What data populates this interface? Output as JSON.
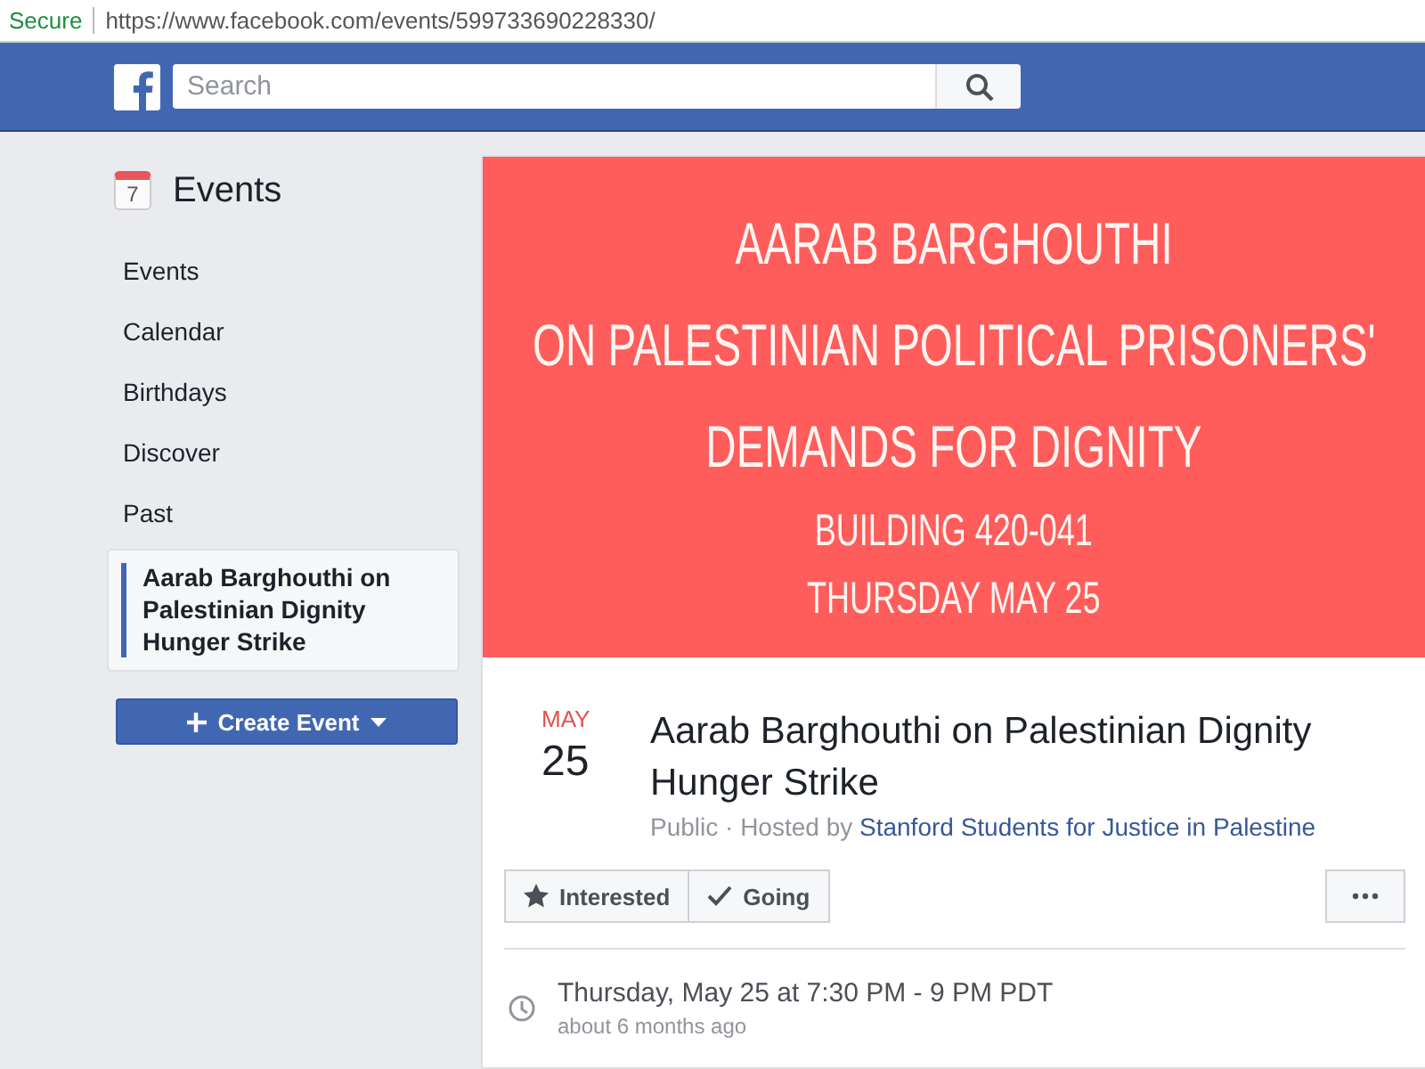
{
  "address_bar": {
    "security": "Secure",
    "url": "https://www.facebook.com/events/599733690228330/"
  },
  "header": {
    "search": {
      "placeholder": "Search"
    }
  },
  "sidebar": {
    "title": "Events",
    "calendar_day": "7",
    "items": [
      {
        "label": "Events",
        "selected": false
      },
      {
        "label": "Calendar",
        "selected": false
      },
      {
        "label": "Birthdays",
        "selected": false
      },
      {
        "label": "Discover",
        "selected": false
      },
      {
        "label": "Past",
        "selected": false
      },
      {
        "label": "Aarab Barghouthi on Palestinian Dignity Hunger Strike",
        "selected": true
      }
    ],
    "create_button": "Create Event"
  },
  "event": {
    "cover": {
      "lines": [
        {
          "text": "AARAB BARGHOUTHI",
          "kind": "large"
        },
        {
          "text": "ON PALESTINIAN POLITICAL PRISONERS'",
          "kind": "large"
        },
        {
          "text": "DEMANDS FOR DIGNITY",
          "kind": "large"
        },
        {
          "text": "BUILDING 420-041",
          "kind": "small"
        },
        {
          "text": "THURSDAY MAY 25",
          "kind": "small"
        }
      ]
    },
    "month": "MAY",
    "day": "25",
    "title": "Aarab Barghouthi on Palestinian Dignity Hunger Strike",
    "meta": "Public · Hosted by",
    "host": "Stanford Students for Justice in Palestine",
    "actions": [
      {
        "label": "Interested",
        "kind": "star"
      },
      {
        "label": "Going",
        "kind": "check"
      }
    ],
    "time": "Thursday, May 25 at 7:30 PM - 9 PM PDT",
    "relative_time": "about 6 months ago"
  }
}
